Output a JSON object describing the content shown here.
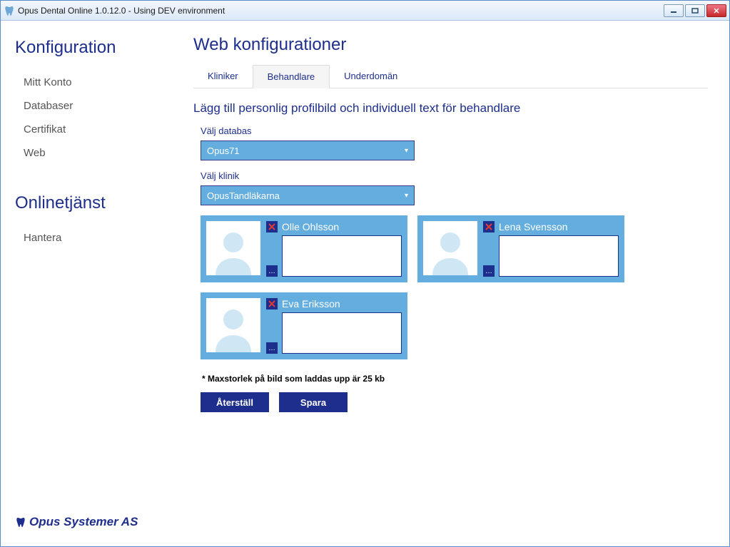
{
  "window": {
    "title": "Opus Dental Online 1.0.12.0 - Using DEV environment"
  },
  "sidebar": {
    "sections": [
      {
        "heading": "Konfiguration",
        "items": [
          "Mitt Konto",
          "Databaser",
          "Certifikat",
          "Web"
        ]
      },
      {
        "heading": "Onlinetjänst",
        "items": [
          "Hantera"
        ]
      }
    ],
    "footer": "Opus Systemer AS"
  },
  "main": {
    "heading": "Web konfigurationer",
    "tabs": [
      "Kliniker",
      "Behandlare",
      "Underdomän"
    ],
    "active_tab": 1,
    "subtitle": "Lägg till personlig profilbild och individuell text för behandlare",
    "db_label": "Välj databas",
    "db_value": "Opus71",
    "clinic_label": "Välj klinik",
    "clinic_value": "OpusTandläkarna",
    "practitioners": [
      {
        "name": "Olle Ohlsson",
        "text": ""
      },
      {
        "name": "Lena Svensson",
        "text": ""
      },
      {
        "name": "Eva Eriksson",
        "text": ""
      }
    ],
    "note": "* Maxstorlek på bild som laddas upp är 25 kb",
    "reset_label": "Återställ",
    "save_label": "Spara"
  }
}
